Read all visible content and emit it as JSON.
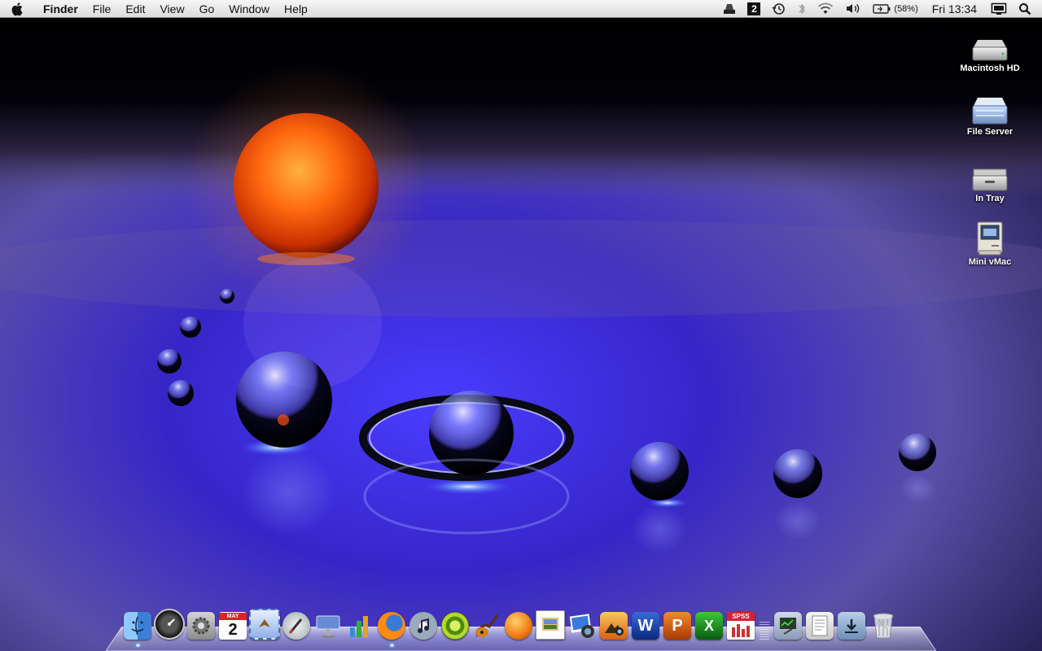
{
  "menubar": {
    "app_name": "Finder",
    "menus": [
      "File",
      "Edit",
      "View",
      "Go",
      "Window",
      "Help"
    ],
    "spaces_number": "2",
    "battery_percent": "(58%)",
    "clock": "Fri 13:34",
    "status_icons": [
      "drive-icon",
      "spaces-icon",
      "time-machine-icon",
      "bluetooth-icon",
      "wifi-icon",
      "volume-icon",
      "battery-icon",
      "display-icon",
      "spotlight-icon"
    ]
  },
  "desktop_icons": [
    {
      "label": "Macintosh HD",
      "icon": "hard-drive-icon"
    },
    {
      "label": "File Server",
      "icon": "file-server-icon"
    },
    {
      "label": "In Tray",
      "icon": "in-tray-icon"
    },
    {
      "label": "Mini vMac",
      "icon": "mini-vmac-icon"
    }
  ],
  "dock": {
    "calendar_month": "MAY",
    "calendar_day": "2",
    "spss_label": "SPSS",
    "apps": [
      "finder-icon",
      "dashboard-icon",
      "system-preferences-icon",
      "ical-icon",
      "mail-icon",
      "script-editor-icon",
      "keynote-icon",
      "numbers-icon",
      "firefox-icon",
      "itunes-icon",
      "growl-icon",
      "garageband-icon",
      "vlc-icon",
      "preview-icon",
      "iphoto-icon",
      "photo-booth-icon",
      "word-icon",
      "powerpoint-icon",
      "excel-icon",
      "spss-icon"
    ],
    "stacks": [
      "utilities-stack-icon",
      "documents-stack-icon",
      "downloads-stack-icon",
      "trash-icon"
    ]
  },
  "colors": {
    "sun": "#ff6a10",
    "floor": "#3b2fd0",
    "sky": "#000000"
  }
}
